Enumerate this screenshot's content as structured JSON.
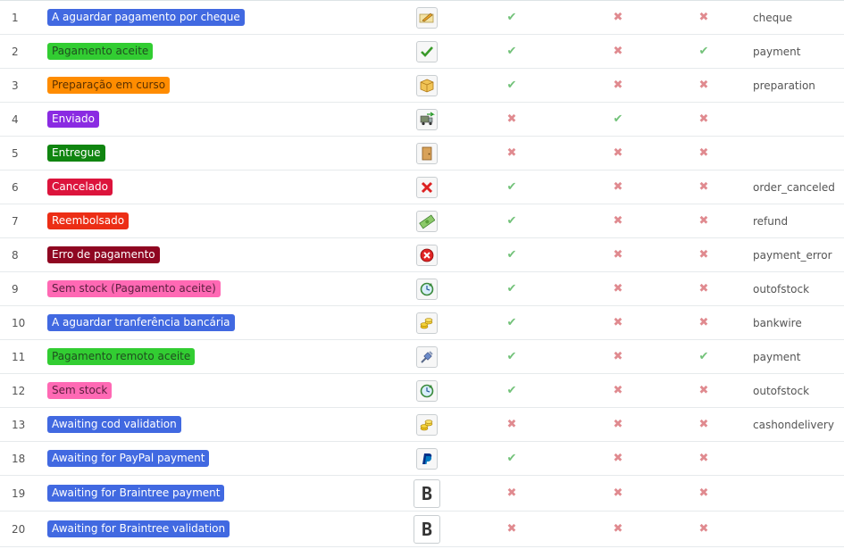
{
  "colors": {
    "check": "#72c279",
    "cross": "#e08a8f"
  },
  "rows": [
    {
      "id": "1",
      "name": "A aguardar pagamento por cheque",
      "color": "#4169e1",
      "text_color": "#ffffff",
      "icon": "cheque-pen-icon",
      "m1": true,
      "m2": false,
      "m3": false,
      "template": "cheque"
    },
    {
      "id": "2",
      "name": "Pagamento aceite",
      "color": "#32cd32",
      "text_color": "#1f4d1f",
      "icon": "checkmark-icon",
      "m1": true,
      "m2": false,
      "m3": true,
      "template": "payment"
    },
    {
      "id": "3",
      "name": "Preparação em curso",
      "color": "#ff8c00",
      "text_color": "#5a3000",
      "icon": "package-icon",
      "m1": true,
      "m2": false,
      "m3": false,
      "template": "preparation"
    },
    {
      "id": "4",
      "name": "Enviado",
      "color": "#8a2be2",
      "text_color": "#ffffff",
      "icon": "delivery-truck-icon",
      "m1": false,
      "m2": true,
      "m3": false,
      "template": ""
    },
    {
      "id": "5",
      "name": "Entregue",
      "color": "#108510",
      "text_color": "#ffffff",
      "icon": "door-icon",
      "m1": false,
      "m2": false,
      "m3": false,
      "template": ""
    },
    {
      "id": "6",
      "name": "Cancelado",
      "color": "#dc143c",
      "text_color": "#ffffff",
      "icon": "red-x-icon",
      "m1": true,
      "m2": false,
      "m3": false,
      "template": "order_canceled"
    },
    {
      "id": "7",
      "name": "Reembolsado",
      "color": "#ec2e15",
      "text_color": "#ffffff",
      "icon": "banknote-icon",
      "m1": true,
      "m2": false,
      "m3": false,
      "template": "refund"
    },
    {
      "id": "8",
      "name": "Erro de pagamento",
      "color": "#8f0621",
      "text_color": "#ffffff",
      "icon": "error-circle-icon",
      "m1": true,
      "m2": false,
      "m3": false,
      "template": "payment_error"
    },
    {
      "id": "9",
      "name": "Sem stock (Pagamento aceite)",
      "color": "#ff69b4",
      "text_color": "#5a1f3e",
      "icon": "refresh-clock-icon",
      "m1": true,
      "m2": false,
      "m3": false,
      "template": "outofstock"
    },
    {
      "id": "10",
      "name": "A aguardar tranferência bancária",
      "color": "#4169e1",
      "text_color": "#ffffff",
      "icon": "coins-icon",
      "m1": true,
      "m2": false,
      "m3": false,
      "template": "bankwire"
    },
    {
      "id": "11",
      "name": "Pagamento remoto aceite",
      "color": "#32cd32",
      "text_color": "#1f4d1f",
      "icon": "plug-connection-icon",
      "m1": true,
      "m2": false,
      "m3": true,
      "template": "payment"
    },
    {
      "id": "12",
      "name": "Sem stock",
      "color": "#ff69b4",
      "text_color": "#5a1f3e",
      "icon": "refresh-clock-icon",
      "m1": true,
      "m2": false,
      "m3": false,
      "template": "outofstock"
    },
    {
      "id": "13",
      "name": "Awaiting cod validation",
      "color": "#4169e1",
      "text_color": "#ffffff",
      "icon": "coins-icon",
      "m1": false,
      "m2": false,
      "m3": false,
      "template": "cashondelivery"
    },
    {
      "id": "18",
      "name": "Awaiting for PayPal payment",
      "color": "#4169e1",
      "text_color": "#ffffff",
      "icon": "paypal-icon",
      "m1": true,
      "m2": false,
      "m3": false,
      "template": ""
    },
    {
      "id": "19",
      "name": "Awaiting for Braintree payment",
      "color": "#4169e1",
      "text_color": "#ffffff",
      "icon": "braintree-b-icon",
      "m1": false,
      "m2": false,
      "m3": false,
      "template": ""
    },
    {
      "id": "20",
      "name": "Awaiting for Braintree validation",
      "color": "#4169e1",
      "text_color": "#ffffff",
      "icon": "braintree-b-icon",
      "m1": false,
      "m2": false,
      "m3": false,
      "template": ""
    }
  ]
}
